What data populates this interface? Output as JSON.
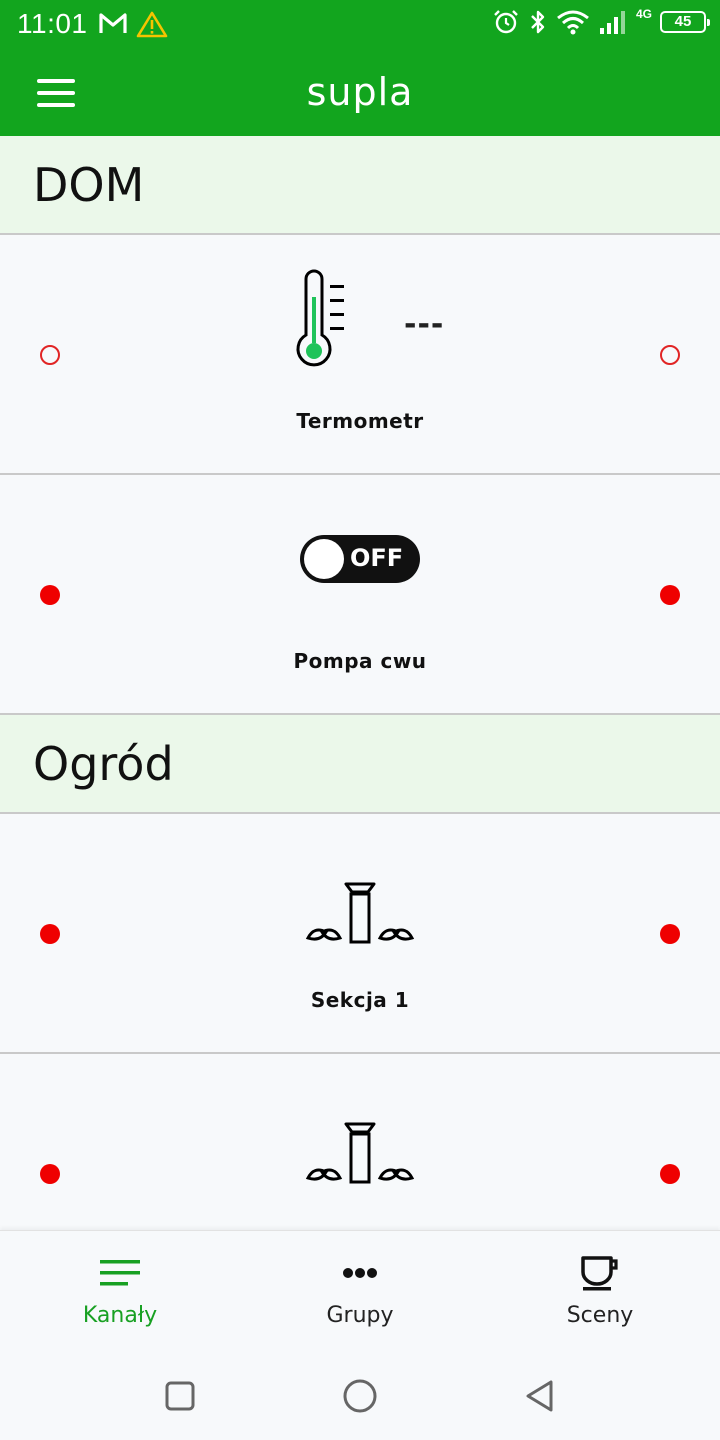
{
  "status_bar": {
    "time": "11:01",
    "network": "4G",
    "battery": "45"
  },
  "app_bar": {
    "title": "supla"
  },
  "locations": [
    {
      "name": "DOM",
      "channels": [
        {
          "label": "Termometr",
          "value": "---",
          "icon": "thermometer-icon",
          "status": "offline"
        },
        {
          "label": "Pompa cwu",
          "icon": "switch-off-icon",
          "switch_text": "OFF",
          "status": "online"
        }
      ]
    },
    {
      "name": "Ogród",
      "channels": [
        {
          "label": "Sekcja 1",
          "icon": "sprinkler-icon",
          "status": "online"
        },
        {
          "label": "",
          "icon": "sprinkler-icon",
          "status": "online"
        }
      ]
    }
  ],
  "bottom_nav": [
    {
      "label": "Kanały",
      "icon": "list-icon",
      "active": true
    },
    {
      "label": "Grupy",
      "icon": "dots-icon",
      "active": false
    },
    {
      "label": "Sceny",
      "icon": "cup-icon",
      "active": false
    }
  ],
  "colors": {
    "primary": "#12a51e",
    "active_nav": "#18a022",
    "location_header_bg": "#ebf8ea",
    "status_online": "#ef0000",
    "status_offline": "#e12525",
    "thermometer_fill": "#1fc35a"
  }
}
